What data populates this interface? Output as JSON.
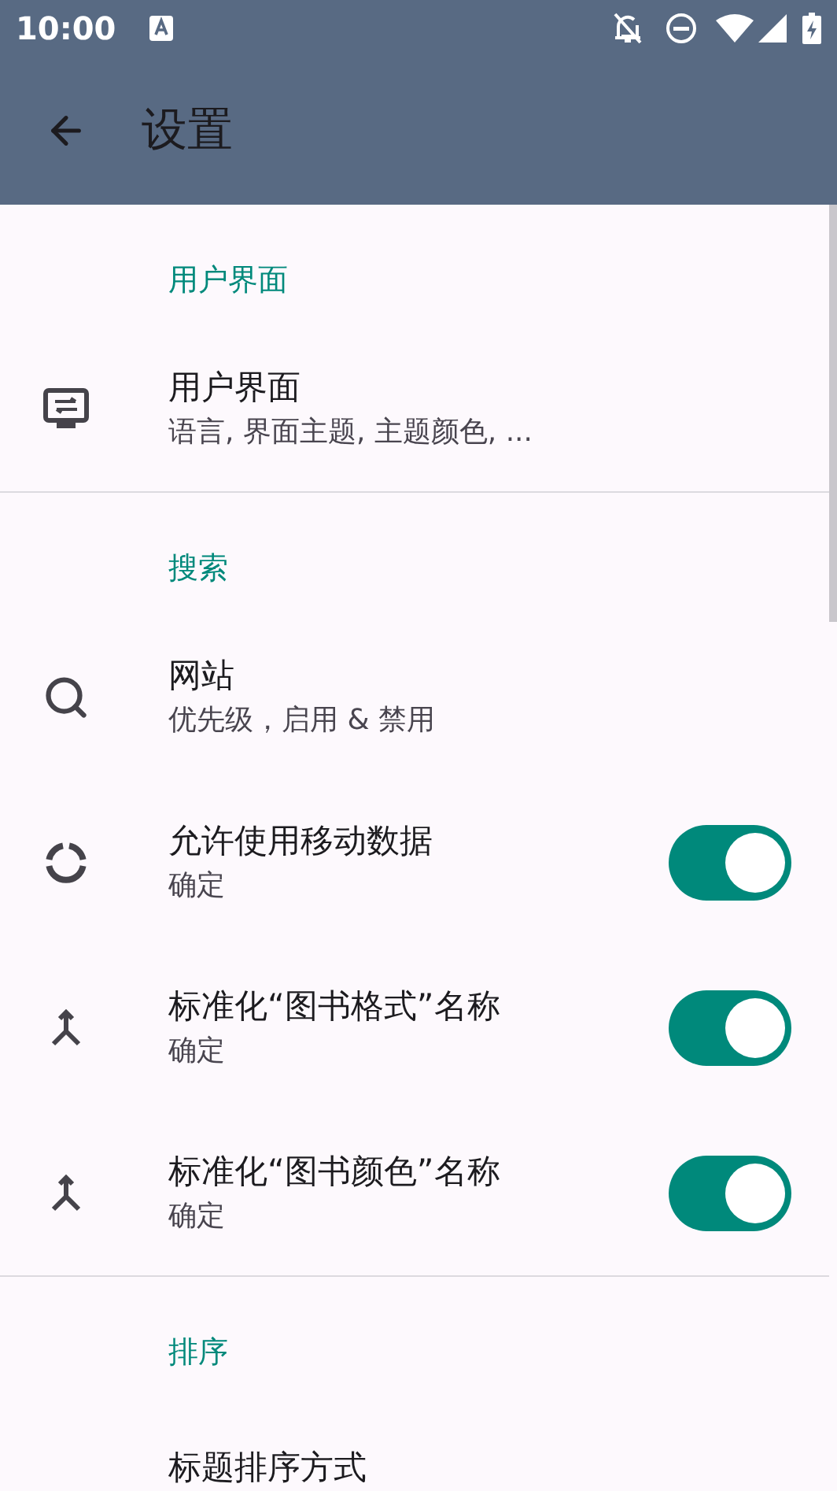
{
  "status_bar": {
    "time": "10:00"
  },
  "app_bar": {
    "title": "设置"
  },
  "sections": [
    {
      "header": "用户界面",
      "items": [
        {
          "kind": "link",
          "title": "用户界面",
          "summary": "语言, 界面主题, 主题颜色, ..."
        }
      ]
    },
    {
      "header": "搜索",
      "items": [
        {
          "kind": "link",
          "title": "网站",
          "summary": "优先级，启用 & 禁用"
        },
        {
          "kind": "switch",
          "title": "允许使用移动数据",
          "summary": "确定",
          "on": true
        },
        {
          "kind": "switch",
          "title": "标准化“图书格式”名称",
          "summary": "确定",
          "on": true
        },
        {
          "kind": "switch",
          "title": "标准化“图书颜色”名称",
          "summary": "确定",
          "on": true
        }
      ]
    },
    {
      "header": "排序",
      "items": [
        {
          "kind": "plain",
          "title": "标题排序方式"
        }
      ]
    }
  ]
}
